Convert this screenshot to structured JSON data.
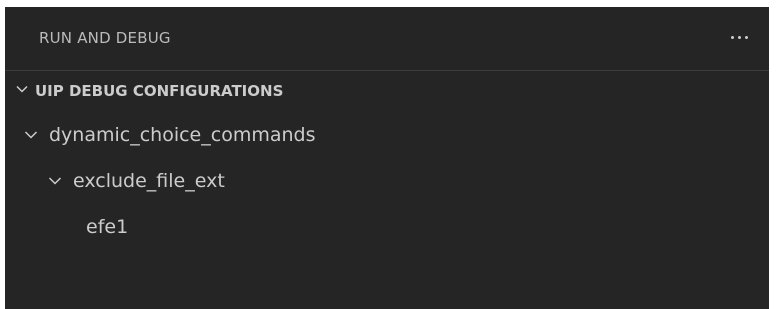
{
  "panel": {
    "title": "RUN AND DEBUG",
    "more_icon": "ellipsis-icon"
  },
  "section": {
    "title": "UIP DEBUG CONFIGURATIONS",
    "expanded": true
  },
  "tree": {
    "items": [
      {
        "label": "dynamic_choice_commands",
        "expanded": true
      },
      {
        "label": "exclude_file_ext",
        "expanded": true
      },
      {
        "label": "efe1"
      }
    ]
  },
  "colors": {
    "background": "#252526",
    "text": "#cccccc",
    "border": "#3c3c3c"
  }
}
